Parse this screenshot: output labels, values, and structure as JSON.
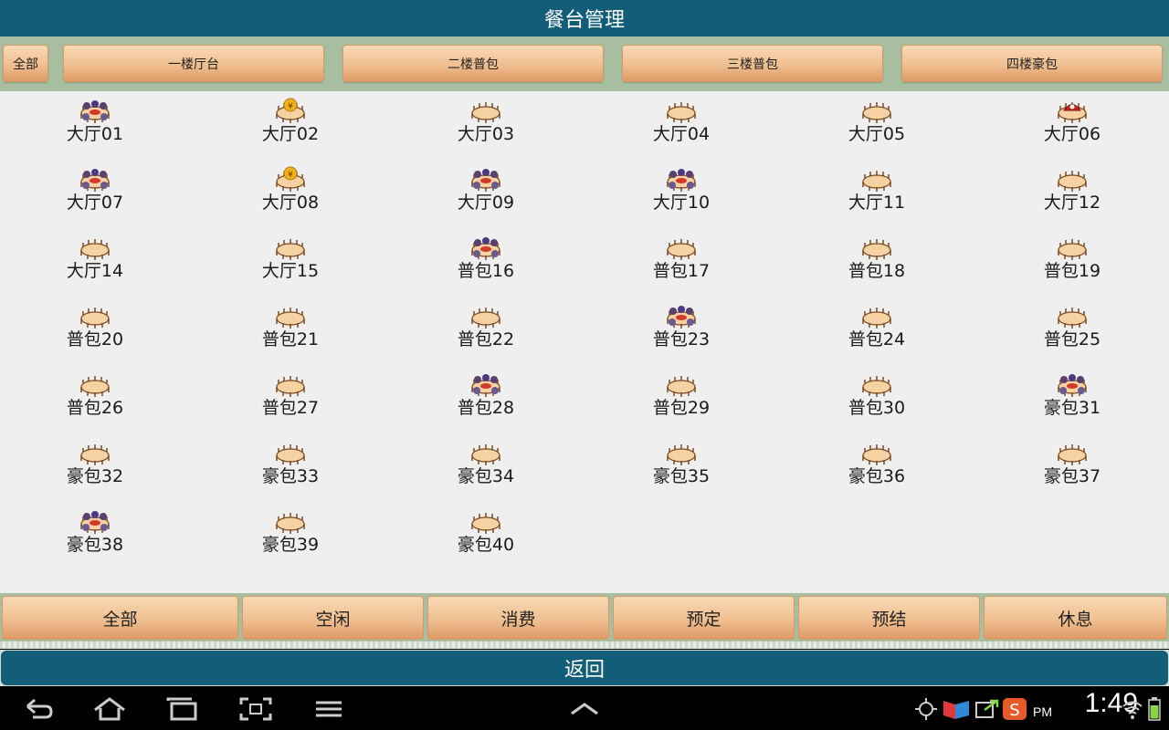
{
  "title": "餐台管理",
  "areas": [
    "全部",
    "一楼厅台",
    "二楼普包",
    "三楼普包",
    "四楼豪包"
  ],
  "tables": [
    {
      "name": "大厅01",
      "state": "busy"
    },
    {
      "name": "大厅02",
      "state": "settle"
    },
    {
      "name": "大厅03",
      "state": "free"
    },
    {
      "name": "大厅04",
      "state": "free"
    },
    {
      "name": "大厅05",
      "state": "free"
    },
    {
      "name": "大厅06",
      "state": "reserved"
    },
    {
      "name": "大厅07",
      "state": "busy"
    },
    {
      "name": "大厅08",
      "state": "settle"
    },
    {
      "name": "大厅09",
      "state": "busy"
    },
    {
      "name": "大厅10",
      "state": "busy"
    },
    {
      "name": "大厅11",
      "state": "free"
    },
    {
      "name": "大厅12",
      "state": "free"
    },
    {
      "name": "大厅14",
      "state": "free"
    },
    {
      "name": "大厅15",
      "state": "free"
    },
    {
      "name": "普包16",
      "state": "busy"
    },
    {
      "name": "普包17",
      "state": "free"
    },
    {
      "name": "普包18",
      "state": "free"
    },
    {
      "name": "普包19",
      "state": "free"
    },
    {
      "name": "普包20",
      "state": "free"
    },
    {
      "name": "普包21",
      "state": "free"
    },
    {
      "name": "普包22",
      "state": "free"
    },
    {
      "name": "普包23",
      "state": "busy"
    },
    {
      "name": "普包24",
      "state": "free"
    },
    {
      "name": "普包25",
      "state": "free"
    },
    {
      "name": "普包26",
      "state": "free"
    },
    {
      "name": "普包27",
      "state": "free"
    },
    {
      "name": "普包28",
      "state": "busy"
    },
    {
      "name": "普包29",
      "state": "free"
    },
    {
      "name": "普包30",
      "state": "free"
    },
    {
      "name": "豪包31",
      "state": "busy"
    },
    {
      "name": "豪包32",
      "state": "free"
    },
    {
      "name": "豪包33",
      "state": "free"
    },
    {
      "name": "豪包34",
      "state": "free"
    },
    {
      "name": "豪包35",
      "state": "free"
    },
    {
      "name": "豪包36",
      "state": "free"
    },
    {
      "name": "豪包37",
      "state": "free"
    },
    {
      "name": "豪包38",
      "state": "busy"
    },
    {
      "name": "豪包39",
      "state": "free"
    },
    {
      "name": "豪包40",
      "state": "free"
    }
  ],
  "status_filters": [
    "全部",
    "空闲",
    "消费",
    "预定",
    "预结",
    "休息"
  ],
  "back_label": "返回",
  "system": {
    "time": "1:49",
    "ampm": "PM",
    "nav_icons": [
      "back-icon",
      "home-icon",
      "recent-apps-icon",
      "screenshot-icon",
      "menu-icon",
      "chevron-up-icon"
    ],
    "tray_icons": [
      "gps-icon",
      "media-icon",
      "sync-icon",
      "sogou-input-icon",
      "wifi-icon",
      "battery-icon"
    ]
  },
  "colors": {
    "header": "#125d78",
    "panel": "#a7bfa0",
    "button": "#f0bf90",
    "grid_bg": "#efefef"
  }
}
